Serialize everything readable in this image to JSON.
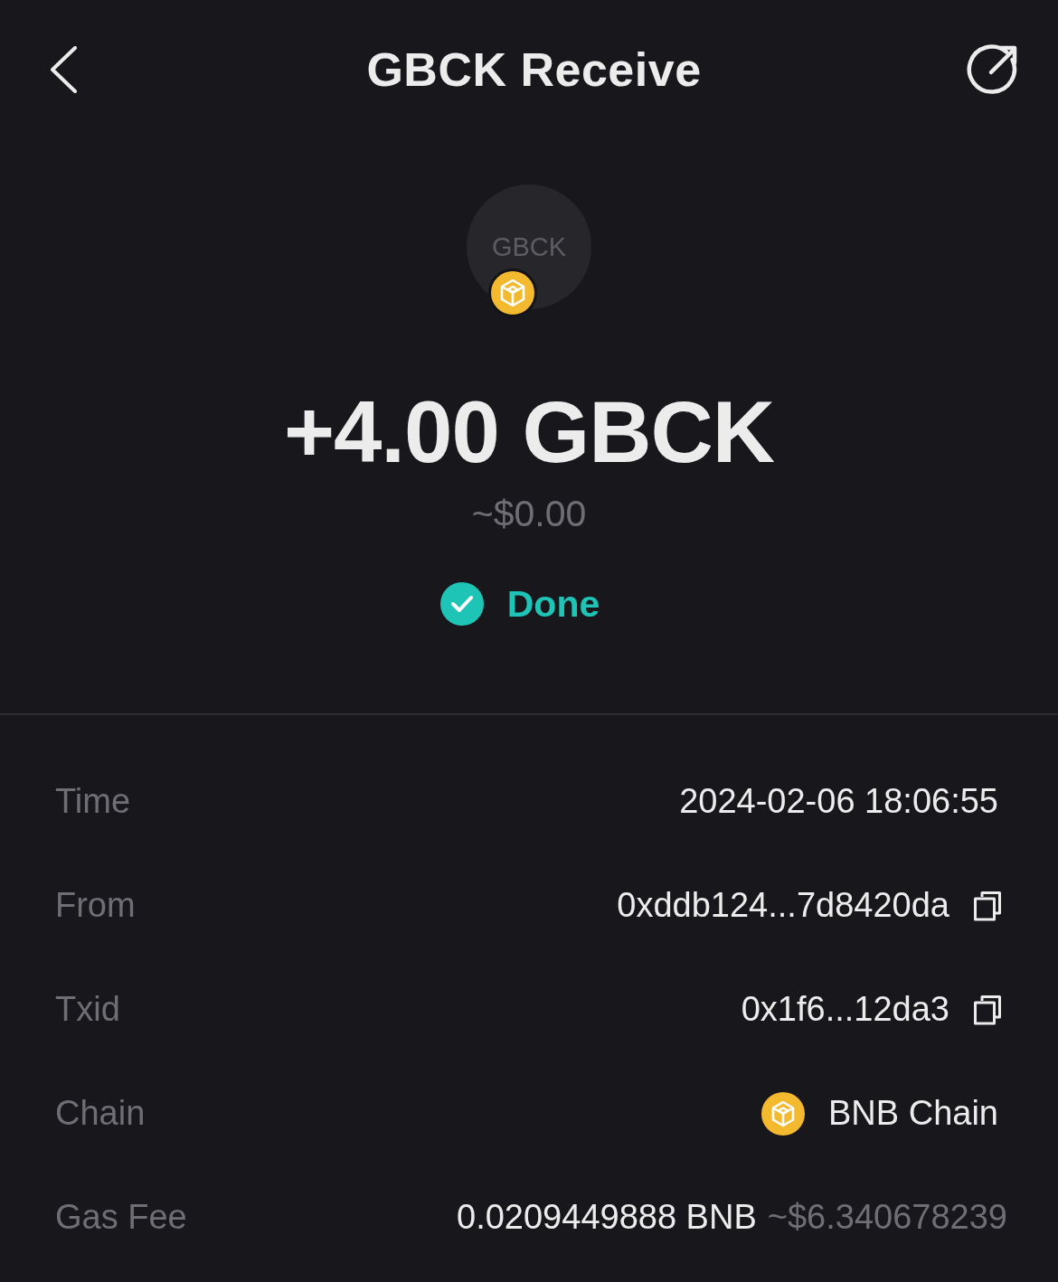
{
  "header": {
    "title": "GBCK Receive"
  },
  "token": {
    "symbol": "GBCK"
  },
  "amount": {
    "value": "+4.00 GBCK",
    "fiat": "~$0.00"
  },
  "status": {
    "label": "Done",
    "kind": "success"
  },
  "details": [
    {
      "label": "Time",
      "value": "2024-02-06 18:06:55",
      "kind": "text"
    },
    {
      "label": "From",
      "value": "0xddb124...7d8420da",
      "kind": "copy"
    },
    {
      "label": "Txid",
      "value": "0x1f6...12da3",
      "kind": "copy"
    },
    {
      "label": "Chain",
      "value": "BNB Chain",
      "kind": "chain"
    },
    {
      "label": "Gas Fee",
      "value": "0.0209449888 BNB",
      "fiat": "~$6.340678239",
      "kind": "fee"
    }
  ]
}
